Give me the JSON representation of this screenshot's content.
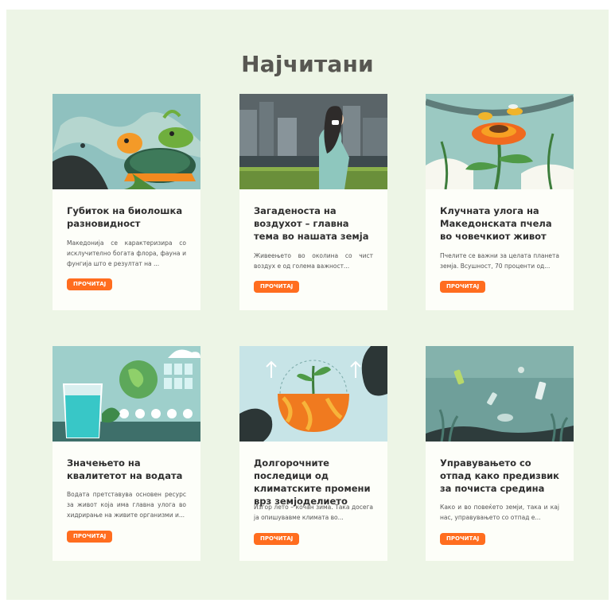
{
  "section": {
    "title": "Најчитани"
  },
  "articles": [
    {
      "title": "Губиток на биолошка разновидност",
      "excerpt": "Македонија се карактеризира со исклучително богата флора, фауна и фунгија што е резултат на ...",
      "button": "ПРОЧИТАЈ",
      "image": "turtle-illustration"
    },
    {
      "title": "Загаденоста на воздухот – главна тема во нашата земја",
      "excerpt": "Живеењето во околина со чист воздух е од голема важност...",
      "button": "ПРОЧИТАЈ",
      "image": "air-pollution-illustration"
    },
    {
      "title": "Клучната улога на Македонската пчела во човечкиот живот",
      "excerpt": "Пчелите се важни за целата планета земја. Всушност, 70 проценти од...",
      "button": "ПРОЧИТАЈ",
      "image": "bee-flower-illustration"
    },
    {
      "title": "Значењето на квалитетот на водата",
      "excerpt": "Водата претставува основен ресурс за живот која има главна улога во хидрирање на живите организми и...",
      "button": "ПРОЧИТАЈ",
      "image": "water-glass-illustration"
    },
    {
      "title": "Долгорочните последици од климатските промени врз земјоделието",
      "excerpt": "Изгор лето – кочан зима. Така досега ја опишувавме климата во...",
      "button": "ПРОЧИТАЈ",
      "image": "earth-plant-illustration"
    },
    {
      "title": "Управувањето со отпад како предизвик за почиста средина",
      "excerpt": "Како и во повеќето земји, така и кај нас, управувањето со отпад е...",
      "button": "ПРОЧИТАЈ",
      "image": "ocean-waste-illustration"
    }
  ],
  "colors": {
    "background": "#edf5e6",
    "card": "#fdfef9",
    "button": "#ff6d1f",
    "title": "#585752"
  }
}
